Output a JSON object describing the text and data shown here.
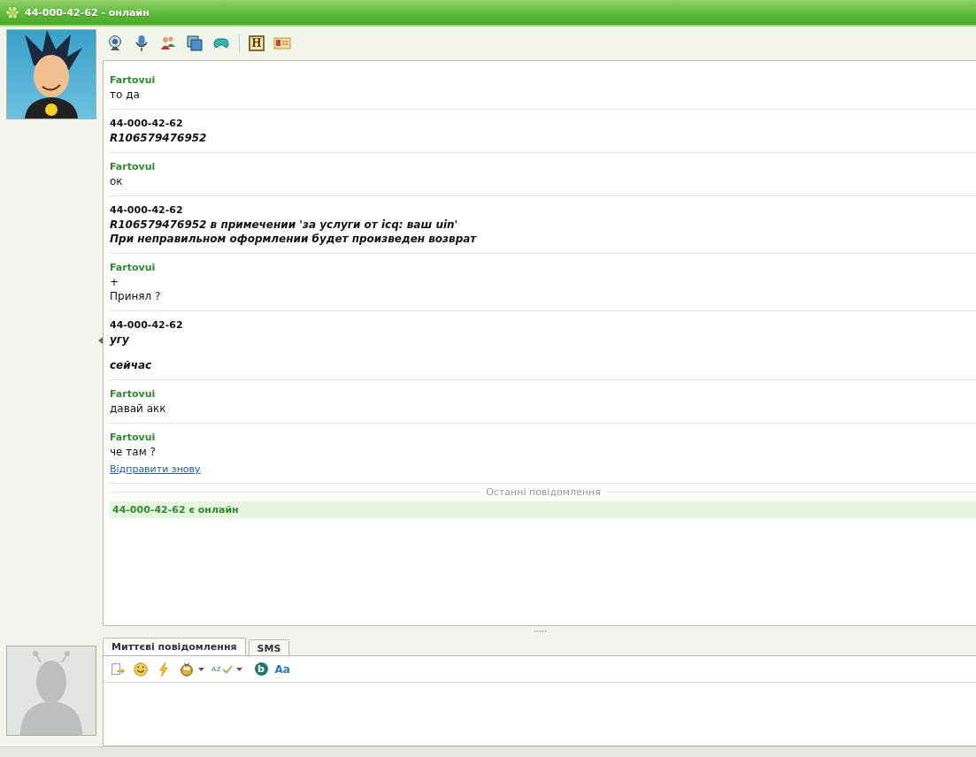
{
  "window": {
    "title": "44-000-42-62 - онлайн"
  },
  "toolbar": {
    "h_label": "H"
  },
  "messages": [
    {
      "kind": "self",
      "sender": "Fartovui",
      "paragraphs": [
        [
          "то да"
        ]
      ]
    },
    {
      "kind": "contact",
      "sender": "44-000-42-62",
      "paragraphs": [
        [
          "R106579476952"
        ]
      ]
    },
    {
      "kind": "self",
      "sender": "Fartovui",
      "paragraphs": [
        [
          "ок"
        ]
      ]
    },
    {
      "kind": "contact",
      "sender": "44-000-42-62",
      "paragraphs": [
        [
          "R106579476952 в примечении 'за услуги от icq: ваш uin'",
          "При неправильном оформлении будет произведен возврат"
        ]
      ]
    },
    {
      "kind": "self",
      "sender": "Fartovui",
      "paragraphs": [
        [
          "+",
          "Принял ?"
        ]
      ]
    },
    {
      "kind": "contact",
      "sender": "44-000-42-62",
      "paragraphs": [
        [
          "угу"
        ],
        [
          "сейчас"
        ]
      ]
    },
    {
      "kind": "self",
      "sender": "Fartovui",
      "paragraphs": [
        [
          "давай акк"
        ]
      ]
    },
    {
      "kind": "self",
      "sender": "Fartovui",
      "paragraphs": [
        [
          "че там ?"
        ]
      ],
      "link": "Відправити знову"
    }
  ],
  "divider": "Останні повідомлення",
  "status": "44-000-42-62 є онлайн",
  "tabs": [
    {
      "label": "Миттєві повідомлення",
      "selected": true
    },
    {
      "label": "SMS",
      "selected": false
    }
  ],
  "input_toolbar": {
    "spell_label": "AZ",
    "b_label": "b",
    "font_label": "Aa"
  }
}
